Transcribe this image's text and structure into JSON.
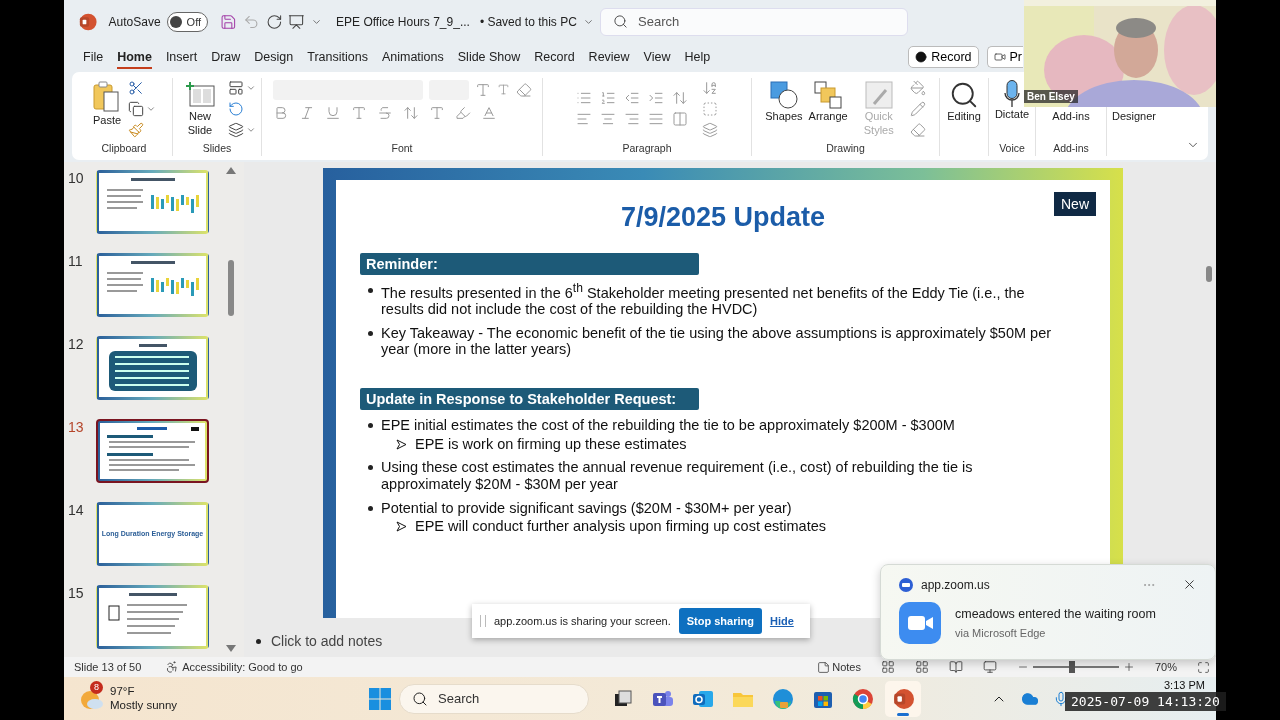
{
  "title_bar": {
    "autosave_label": "AutoSave",
    "autosave_toggle": {
      "on": false,
      "label": "Off"
    },
    "document_title": "EPE Office Hours 7_9_...",
    "save_status": "• Saved to this PC",
    "search": {
      "placeholder": "Search"
    }
  },
  "camera": {
    "kind": "picture",
    "name": "Ben Elsey"
  },
  "ribbon_tabs": [
    {
      "label": "File",
      "selected": false
    },
    {
      "label": "Home",
      "selected": true
    },
    {
      "label": "Insert",
      "selected": false
    },
    {
      "label": "Draw",
      "selected": false
    },
    {
      "label": "Design",
      "selected": false
    },
    {
      "label": "Transitions",
      "selected": false
    },
    {
      "label": "Animations",
      "selected": false
    },
    {
      "label": "Slide Show",
      "selected": false
    },
    {
      "label": "Record",
      "selected": false
    },
    {
      "label": "Review",
      "selected": false
    },
    {
      "label": "View",
      "selected": false
    },
    {
      "label": "Help",
      "selected": false
    }
  ],
  "ribbon_actions": [
    {
      "kind": "record",
      "label": "Record"
    },
    {
      "kind": "present",
      "label": "Pr"
    }
  ],
  "ribbon_groups": [
    {
      "kind": "clipboard",
      "name": "Clipboard",
      "buttons": [
        {
          "kind": "paste",
          "label": "Paste",
          "disabled": false
        }
      ]
    },
    {
      "kind": "slides",
      "name": "Slides",
      "buttons": [
        {
          "kind": "new-slide",
          "label": "New Slide",
          "disabled": false
        }
      ]
    },
    {
      "kind": "font",
      "name": "Font"
    },
    {
      "kind": "paragraph",
      "name": "Paragraph"
    },
    {
      "kind": "drawing",
      "name": "Drawing",
      "buttons": [
        {
          "kind": "shapes",
          "label": "Shapes",
          "disabled": false
        },
        {
          "kind": "arrange",
          "label": "Arrange",
          "disabled": false
        },
        {
          "kind": "quick-styles",
          "label": "Quick Styles",
          "disabled": true
        }
      ]
    },
    {
      "kind": "editing",
      "buttons": [
        {
          "kind": "editing",
          "label": "Editing",
          "disabled": false
        }
      ]
    },
    {
      "kind": "voice",
      "name": "Voice",
      "buttons": [
        {
          "kind": "dictate",
          "label": "Dictate",
          "disabled": false
        }
      ]
    },
    {
      "kind": "addins",
      "name": "Add-ins",
      "buttons": [
        {
          "kind": "addins",
          "label": "Add-ins",
          "disabled": false
        }
      ]
    },
    {
      "kind": "designer",
      "buttons": [
        {
          "kind": "designer",
          "label": "Designer",
          "disabled": false
        }
      ]
    }
  ],
  "thumbnails": [
    {
      "number": "10",
      "kind": "chart",
      "selected": false
    },
    {
      "number": "11",
      "kind": "chart",
      "selected": false
    },
    {
      "number": "12",
      "kind": "panel",
      "selected": false
    },
    {
      "number": "13",
      "kind": "bullets",
      "selected": true
    },
    {
      "number": "14",
      "kind": "title",
      "title": "Long Duration Energy Storage",
      "selected": false
    },
    {
      "number": "15",
      "kind": "list",
      "selected": false
    }
  ],
  "slide": {
    "title": "7/9/2025 Update",
    "badge": "New",
    "sections": [
      {
        "heading": "Reminder:",
        "bullets": [
          {
            "text": "The results presented in the 6$^{th}$ Stakeholder meeting presented net benefits of the Eddy Tie (i.e., the results did not include the cost of the rebuilding the HVDC)"
          },
          {
            "text": "Key Takeaway - The economic benefit of the tie using the above assumptions is approximately $50M per year (more in the latter years)"
          }
        ]
      },
      {
        "heading": "Update in Response to Stakeholder Request:",
        "bullets": [
          {
            "text": "EPE initial estimates the cost of the rebuilding the tie to be approximately $200M - $300M",
            "children": [
              {
                "text": "EPE is work on firming up these estimates"
              }
            ]
          },
          {
            "text": "Using these cost estimates the annual revenue requirement (i.e., cost) of rebuilding the tie is approximately $20M - $30M per year"
          },
          {
            "text": "Potential to provide significant savings ($20M - $30M+ per year)",
            "children": [
              {
                "text": "EPE will conduct further analysis upon firming up cost estimates"
              }
            ]
          }
        ]
      }
    ]
  },
  "notes": {
    "placeholder": "Click to add notes"
  },
  "status_bar": {
    "slide_count": "Slide 13 of 50",
    "accessibility": "Accessibility: Good to go",
    "notes_label": "Notes",
    "zoom": {
      "level": 0.45,
      "reading": "70%"
    }
  },
  "sharing_bar": {
    "message": "app.zoom.us is sharing your screen.",
    "stop_label": "Stop sharing",
    "hide_label": "Hide"
  },
  "notification": {
    "source": "app.zoom.us",
    "message": "cmeadows entered the waiting room",
    "via": "via Microsoft Edge"
  },
  "taskbar": {
    "weather": {
      "badge": "8",
      "temperature": "97°F",
      "condition": "Mostly sunny"
    },
    "search": {
      "placeholder": "Search"
    },
    "apps": [
      {
        "kind": "task-view",
        "selected": false
      },
      {
        "kind": "teams",
        "selected": false
      },
      {
        "kind": "outlook",
        "selected": false
      },
      {
        "kind": "explorer",
        "selected": false
      },
      {
        "kind": "edge",
        "selected": false
      },
      {
        "kind": "store",
        "selected": false
      },
      {
        "kind": "chrome",
        "selected": false
      },
      {
        "kind": "powerpoint",
        "selected": true
      }
    ],
    "clock": "3:13 PM",
    "timestamp": "2025-07-09 14:13:20"
  }
}
